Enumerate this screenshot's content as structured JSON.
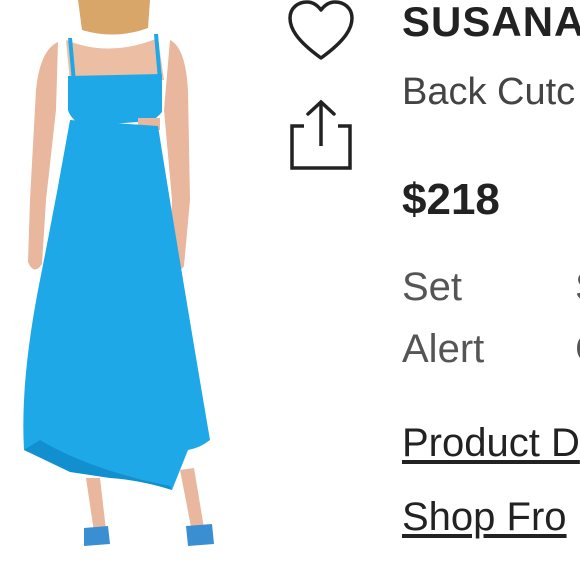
{
  "product": {
    "brand": "SUSANA",
    "title": "Back Cutc",
    "price": "$218"
  },
  "price_alert": {
    "line1": "Set",
    "line2": "Alert",
    "line1_cut": "S",
    "line2_cut": "C"
  },
  "links": {
    "details": "Product D",
    "shop_from": "Shop Fro"
  },
  "icons": {
    "favorite": "heart-icon",
    "share": "share-icon"
  },
  "colors": {
    "dress": "#1fa8e8",
    "text_dark": "#222222",
    "text_gray": "#555555"
  }
}
